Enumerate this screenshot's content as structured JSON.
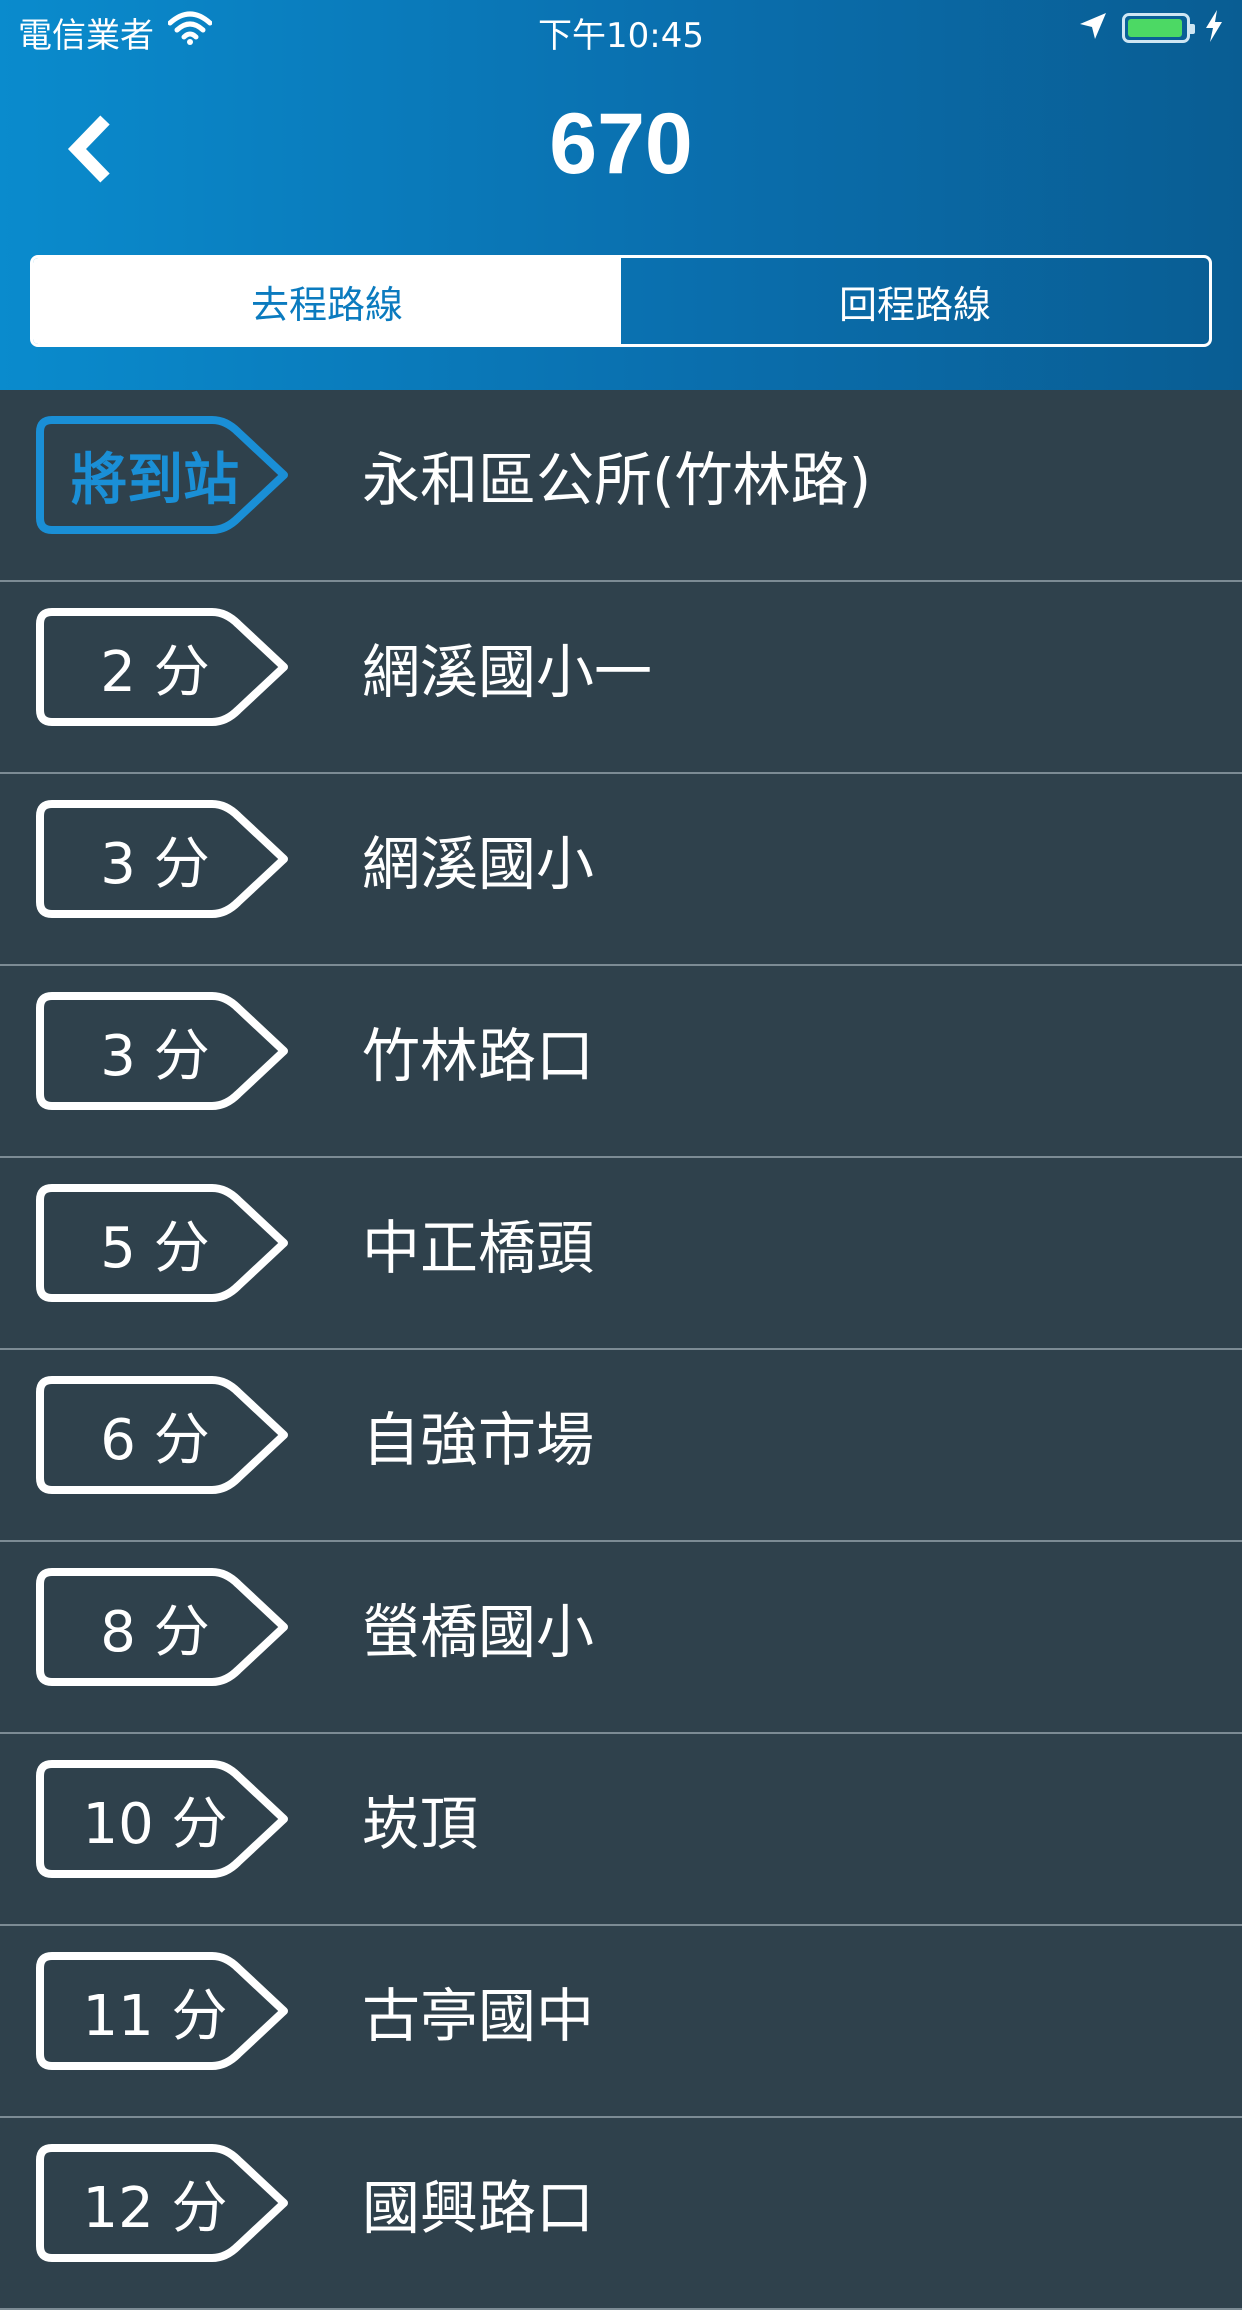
{
  "status_bar": {
    "carrier": "電信業者",
    "time": "下午10:45",
    "battery_level": 1.0
  },
  "nav": {
    "title": "670",
    "back_icon": "chevron-left-icon"
  },
  "tabs": [
    {
      "label": "去程路線",
      "active": true
    },
    {
      "label": "回程路線",
      "active": false
    }
  ],
  "colors": {
    "header_start": "#0a8bcd",
    "header_end": "#095d93",
    "list_bg": "#2f414c",
    "arriving_accent": "#1a8fd6",
    "battery_green": "#4cd964"
  },
  "stops": [
    {
      "eta": "將到站",
      "name": "永和區公所(竹林路)",
      "arriving": true
    },
    {
      "eta": "2 分",
      "name": "網溪國小一",
      "arriving": false
    },
    {
      "eta": "3 分",
      "name": "網溪國小",
      "arriving": false
    },
    {
      "eta": "3 分",
      "name": "竹林路口",
      "arriving": false
    },
    {
      "eta": "5 分",
      "name": "中正橋頭",
      "arriving": false
    },
    {
      "eta": "6 分",
      "name": "自強市場",
      "arriving": false
    },
    {
      "eta": "8 分",
      "name": "螢橋國小",
      "arriving": false
    },
    {
      "eta": "10 分",
      "name": "崁頂",
      "arriving": false
    },
    {
      "eta": "11 分",
      "name": "古亭國中",
      "arriving": false
    },
    {
      "eta": "12 分",
      "name": "國興路口",
      "arriving": false
    }
  ]
}
